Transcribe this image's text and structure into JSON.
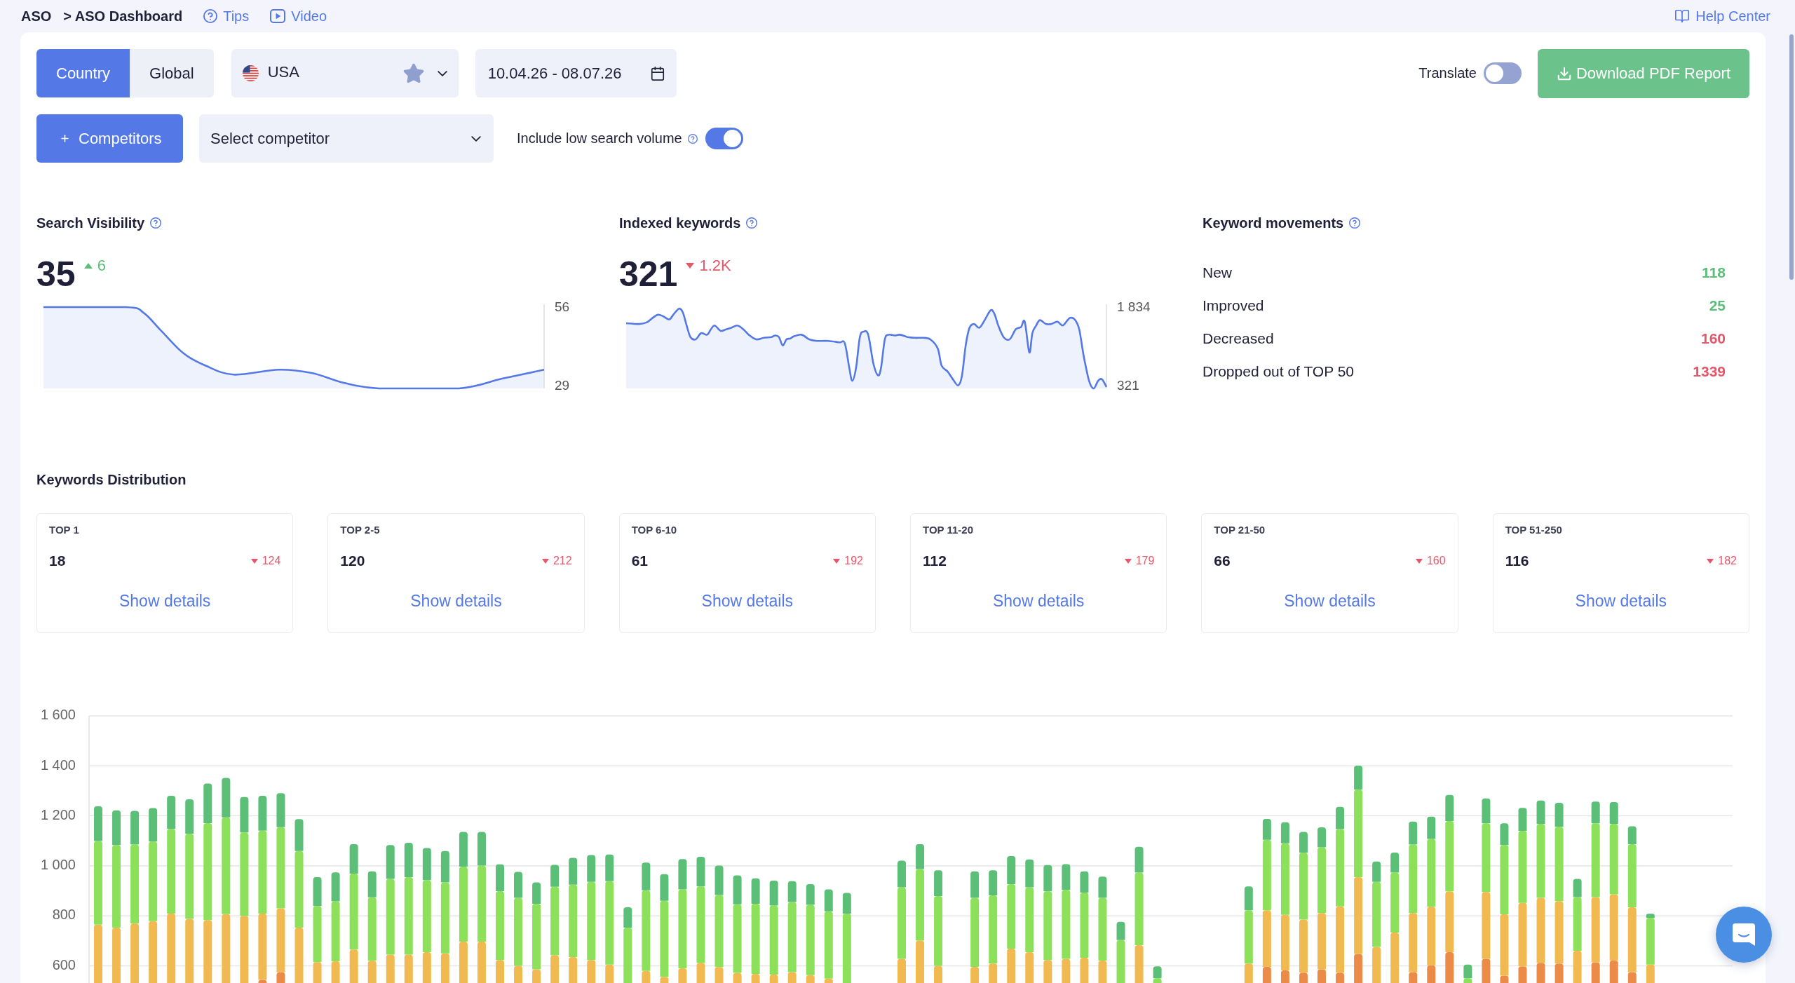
{
  "breadcrumb": {
    "root": "ASO",
    "current": "> ASO Dashboard"
  },
  "header_links": [
    {
      "kind": "help",
      "label": "Tips"
    },
    {
      "kind": "video",
      "label": "Video"
    }
  ],
  "help_center": {
    "label": "Help Center"
  },
  "scope_tabs": [
    {
      "label": "Country",
      "selected": true
    },
    {
      "label": "Global",
      "selected": false
    }
  ],
  "country_select": {
    "value": "USA"
  },
  "date_range": {
    "value": "10.04.26 - 08.07.26"
  },
  "translate": {
    "label": "Translate",
    "on": false
  },
  "download_button": {
    "label": "Download PDF Report"
  },
  "competitors_button": {
    "label": "Competitors"
  },
  "competitor_select": {
    "placeholder": "Select competitor"
  },
  "low_search_volume": {
    "label": "Include low search volume",
    "on": true
  },
  "metrics": [
    {
      "title": "Search Visibility",
      "value": "35",
      "change": "6",
      "positive": true,
      "axis_max": "56",
      "axis_min": "29"
    },
    {
      "title": "Indexed keywords",
      "value": "321",
      "change": "1.2K",
      "positive": false,
      "axis_max": "1 834",
      "axis_min": "321"
    }
  ],
  "keyword_movements": {
    "title": "Keyword movements",
    "rows": [
      {
        "label": "New",
        "value": "118",
        "positive": true
      },
      {
        "label": "Improved",
        "value": "25",
        "positive": true
      },
      {
        "label": "Decreased",
        "value": "160",
        "positive": false
      },
      {
        "label": "Dropped out of TOP 50",
        "value": "1339",
        "positive": false
      }
    ]
  },
  "keywords_distribution": {
    "title": "Keywords Distribution",
    "cards": [
      {
        "label": "TOP 1",
        "value": "18",
        "change": "124",
        "positive": false,
        "link": "Show details"
      },
      {
        "label": "TOP 2-5",
        "value": "120",
        "change": "212",
        "positive": false,
        "link": "Show details"
      },
      {
        "label": "TOP 6-10",
        "value": "61",
        "change": "192",
        "positive": false,
        "link": "Show details"
      },
      {
        "label": "TOP 11-20",
        "value": "112",
        "change": "179",
        "positive": false,
        "link": "Show details"
      },
      {
        "label": "TOP 21-50",
        "value": "66",
        "change": "160",
        "positive": false,
        "link": "Show details"
      },
      {
        "label": "TOP 51-250",
        "value": "116",
        "change": "182",
        "positive": false,
        "link": "Show details"
      }
    ]
  },
  "distribution_chart": {
    "chart_data": {
      "type": "bar",
      "stacked": true,
      "grid": true,
      "ylim": [
        0,
        1600
      ],
      "yticks": [
        {
          "value": 600,
          "label": "600"
        },
        {
          "value": 800,
          "label": "800"
        },
        {
          "value": 1000,
          "label": "1 000"
        },
        {
          "value": 1200,
          "label": "1 200"
        },
        {
          "value": 1400,
          "label": "1 400"
        },
        {
          "value": 1600,
          "label": "1 600"
        }
      ],
      "series": [
        {
          "color": "#ec8a48",
          "values": [
            null,
            null,
            null,
            null,
            null,
            null,
            null,
            null,
            null,
            544,
            575,
            null,
            null,
            null,
            null,
            null,
            null,
            null,
            null,
            null,
            null,
            null,
            null,
            null,
            null,
            null,
            null,
            null,
            null,
            null,
            null,
            null,
            null,
            null,
            null,
            null,
            null,
            null,
            null,
            null,
            null,
            null,
            null,
            null,
            null,
            null,
            null,
            null,
            null,
            null,
            null,
            null,
            null,
            null,
            null,
            null,
            null,
            null,
            null,
            null,
            null,
            null,
            null,
            null,
            596,
            582,
            573,
            586,
            573,
            648,
            null,
            null,
            575,
            602,
            655,
            null,
            628,
            561,
            598,
            612,
            609,
            null,
            614,
            621,
            575,
            null,
            null,
            null,
            null,
            null
          ]
        },
        {
          "color": "#f0ba50",
          "values": [
            765,
            753,
            769,
            779,
            809,
            788,
            783,
            807,
            800,
            265,
            255,
            753,
            615,
            618,
            665,
            620,
            645,
            645,
            655,
            650,
            697,
            697,
            623,
            600,
            586,
            642,
            635,
            623,
            605,
            null,
            580,
            556,
            590,
            612,
            595,
            572,
            568,
            565,
            575,
            563,
            549,
            null,
            null,
            null,
            628,
            701,
            600,
            null,
            596,
            609,
            669,
            655,
            623,
            628,
            632,
            621,
            null,
            683,
            null,
            null,
            null,
            null,
            null,
            609,
            226,
            222,
            212,
            225,
            265,
            307,
            676,
            733,
            236,
            234,
            243,
            null,
            267,
            245,
            254,
            260,
            250,
            660,
            261,
            265,
            259,
            605,
            null,
            null,
            null,
            null
          ]
        },
        {
          "color": "#8ce05a",
          "values": [
            334,
            330,
            316,
            318,
            339,
            341,
            388,
            387,
            334,
            332,
            325,
            306,
            224,
            240,
            304,
            254,
            303,
            310,
            288,
            284,
            300,
            304,
            276,
            272,
            262,
            274,
            290,
            313,
            334,
            753,
            322,
            304,
            316,
            306,
            288,
            274,
            280,
            276,
            280,
            281,
            269,
            809,
            null,
            null,
            286,
            286,
            279,
            null,
            276,
            273,
            258,
            259,
            275,
            276,
            261,
            251,
            703,
            290,
            550,
            null,
            null,
            null,
            null,
            213,
            282,
            286,
            268,
            263,
            309,
            350,
            260,
            240,
            274,
            272,
            281,
            550,
            275,
            277,
            288,
            296,
            297,
            215,
            295,
            282,
            253,
            187,
            null,
            null,
            null,
            null
          ]
        },
        {
          "color": "#5cbf78",
          "values": [
            139,
            139,
            135,
            134,
            132,
            137,
            158,
            158,
            141,
            139,
            136,
            128,
            116,
            116,
            118,
            104,
            135,
            137,
            128,
            125,
            139,
            135,
            107,
            104,
            86,
            88,
            107,
            107,
            106,
            81,
            111,
            107,
            121,
            118,
            118,
            116,
            102,
            100,
            84,
            83,
            88,
            83,
            null,
            null,
            107,
            100,
            103,
            null,
            106,
            100,
            112,
            112,
            105,
            103,
            85,
            85,
            73,
            103,
            48,
            null,
            null,
            null,
            null,
            96,
            84,
            84,
            83,
            80,
            89,
            96,
            81,
            80,
            92,
            89,
            105,
            55,
            100,
            87,
            92,
            93,
            96,
            73,
            87,
            87,
            71,
            16,
            null,
            null,
            null,
            null
          ]
        }
      ]
    }
  }
}
